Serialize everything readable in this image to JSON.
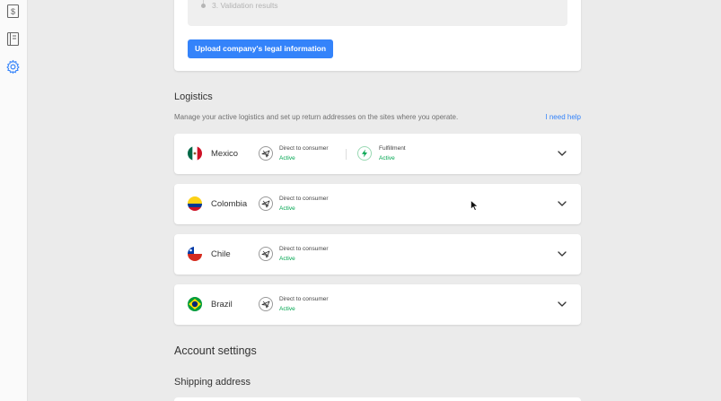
{
  "sidebar": {
    "icons": [
      "dollar-receipt-icon",
      "ledger-icon",
      "gear-icon"
    ],
    "colors": {
      "active": "#3483fa",
      "inactive": "#666666"
    }
  },
  "validation": {
    "step_label": "3. Validation results",
    "upload_button": "Upload company's legal information"
  },
  "logistics": {
    "title": "Logistics",
    "description": "Manage your active logistics and set up return addresses on the sites where you operate.",
    "help_link": "I need help",
    "rows": [
      {
        "country": "Mexico",
        "flag": "mexico-flag-icon",
        "modes": [
          {
            "name": "Direct to consumer",
            "status": "Active",
            "icon": "plane-icon"
          },
          {
            "name": "Fulfillment",
            "status": "Active",
            "icon": "lightning-icon"
          }
        ]
      },
      {
        "country": "Colombia",
        "flag": "colombia-flag-icon",
        "modes": [
          {
            "name": "Direct to consumer",
            "status": "Active",
            "icon": "plane-icon"
          }
        ]
      },
      {
        "country": "Chile",
        "flag": "chile-flag-icon",
        "modes": [
          {
            "name": "Direct to consumer",
            "status": "Active",
            "icon": "plane-icon"
          }
        ]
      },
      {
        "country": "Brazil",
        "flag": "brazil-flag-icon",
        "modes": [
          {
            "name": "Direct to consumer",
            "status": "Active",
            "icon": "plane-icon"
          }
        ]
      }
    ],
    "colors": {
      "status_active": "#00a650",
      "link": "#3483fa",
      "fulfillment_icon": "#00a650"
    }
  },
  "account_settings": {
    "title": "Account settings",
    "shipping_address_title": "Shipping address"
  }
}
